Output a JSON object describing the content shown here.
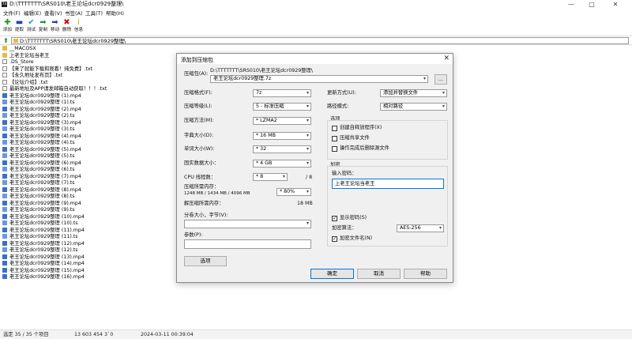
{
  "window": {
    "title": "D:\\TTTTTTT\\SRS010\\老王论坛dcr0929整理\\",
    "logo": "7z",
    "minimize": "—",
    "maximize": "□",
    "close": "✕"
  },
  "menu": [
    "文件(F)",
    "编辑(E)",
    "查看(V)",
    "书签(A)",
    "工具(T)",
    "帮助(H)"
  ],
  "toolbar": [
    {
      "label": "添加",
      "icon": "plus-icon",
      "glyph": "✚",
      "color": "#1a9a1a"
    },
    {
      "label": "提取",
      "icon": "minus-icon",
      "glyph": "▬",
      "color": "#1d3fbf"
    },
    {
      "label": "测试",
      "icon": "check-icon",
      "glyph": "✔",
      "color": "#1aa0b8"
    },
    {
      "label": "复制",
      "icon": "copy-arrow-icon",
      "glyph": "➡",
      "color": "#1a9a4a"
    },
    {
      "label": "移动",
      "icon": "move-arrow-icon",
      "glyph": "➡",
      "color": "#1d3fbf"
    },
    {
      "label": "删除",
      "icon": "delete-icon",
      "glyph": "✖",
      "color": "#d01010"
    },
    {
      "label": "信息",
      "icon": "info-icon",
      "glyph": "i",
      "color": "#c9a000"
    }
  ],
  "address": {
    "path": "D:\\TTTTTTT\\SRS010\\老王论坛dcr0929整理\\"
  },
  "files": [
    {
      "name": "__MACOSX",
      "type": "folder"
    },
    {
      "name": "上老王论坛当老王",
      "type": "folder"
    },
    {
      "name": ".DS_Store",
      "type": "file"
    },
    {
      "name": "【来了就能下载和观看！纯免费】.txt",
      "type": "file"
    },
    {
      "name": "【永久地址发布页】.txt",
      "type": "file"
    },
    {
      "name": "【论坛介绍】.txt",
      "type": "file"
    },
    {
      "name": "最新地址及APP请发邮箱自动获取！！！.txt",
      "type": "file"
    },
    {
      "name": "老王论坛dcr0929整理 (1).mp4",
      "type": "media"
    },
    {
      "name": "老王论坛dcr0929整理 (1).ts",
      "type": "ts"
    },
    {
      "name": "老王论坛dcr0929整理 (2).mp4",
      "type": "media"
    },
    {
      "name": "老王论坛dcr0929整理 (2).ts",
      "type": "ts"
    },
    {
      "name": "老王论坛dcr0929整理 (3).mp4",
      "type": "media"
    },
    {
      "name": "老王论坛dcr0929整理 (3).ts",
      "type": "ts"
    },
    {
      "name": "老王论坛dcr0929整理 (4).mp4",
      "type": "media"
    },
    {
      "name": "老王论坛dcr0929整理 (4).ts",
      "type": "ts"
    },
    {
      "name": "老王论坛dcr0929整理 (5).mp4",
      "type": "media"
    },
    {
      "name": "老王论坛dcr0929整理 (5).ts",
      "type": "ts"
    },
    {
      "name": "老王论坛dcr0929整理 (6).mp4",
      "type": "media"
    },
    {
      "name": "老王论坛dcr0929整理 (6).ts",
      "type": "ts"
    },
    {
      "name": "老王论坛dcr0929整理 (7).mp4",
      "type": "media"
    },
    {
      "name": "老王论坛dcr0929整理 (7).ts",
      "type": "ts"
    },
    {
      "name": "老王论坛dcr0929整理 (8).mp4",
      "type": "media"
    },
    {
      "name": "老王论坛dcr0929整理 (8).ts",
      "type": "ts"
    },
    {
      "name": "老王论坛dcr0929整理 (9).mp4",
      "type": "media"
    },
    {
      "name": "老王论坛dcr0929整理 (9).ts",
      "type": "ts"
    },
    {
      "name": "老王论坛dcr0929整理 (10).mp4",
      "type": "media"
    },
    {
      "name": "老王论坛dcr0929整理 (10).ts",
      "type": "ts"
    },
    {
      "name": "老王论坛dcr0929整理 (11).mp4",
      "type": "media"
    },
    {
      "name": "老王论坛dcr0929整理 (11).ts",
      "type": "ts"
    },
    {
      "name": "老王论坛dcr0929整理 (12).mp4",
      "type": "media"
    },
    {
      "name": "老王论坛dcr0929整理 (12).ts",
      "type": "ts"
    },
    {
      "name": "老王论坛dcr0929整理 (13).mp4",
      "type": "media"
    },
    {
      "name": "老王论坛dcr0929整理 (14).mp4",
      "type": "media"
    },
    {
      "name": "老王论坛dcr0929整理 (15).mp4",
      "type": "media"
    },
    {
      "name": "老王论坛dcr0929整理 (16).mp4",
      "type": "media"
    }
  ],
  "status": {
    "selection": "选定 35 / 35 个项目",
    "size": "13 603 454 3`0",
    "modified": "2024-03-11 00:39:04"
  },
  "dialog": {
    "title": "添加到压缩包",
    "close": "✕",
    "archive_label": "压缩包(A):",
    "archive_dir": "D:\\TTTTTTT\\SRS010\\老王论坛dcr0929整理\\",
    "archive_name": "老王论坛dcr0929整理.7z",
    "browse": "...",
    "format_label": "压缩格式(F):",
    "format_value": "7z",
    "level_label": "压缩等级(L):",
    "level_value": "5 - 标准压缩",
    "method_label": "压缩方法(M):",
    "method_value": "* LZMA2",
    "dict_label": "字典大小(D):",
    "dict_value": "* 16 MB",
    "word_label": "单词大小(W):",
    "word_value": "* 32",
    "solid_label": "固实数据大小：",
    "solid_value": "* 4 GB",
    "cpu_label": "CPU 线程数：",
    "cpu_value": "* 8",
    "cpu_max": "/ 8",
    "mem_label": "压缩所需内存：",
    "mem_detail": "1248 MB / 1434 MB / 4096 MB",
    "mem_value": "* 80%",
    "decomp_label": "解压缩所需内存：",
    "decomp_value": "18 MB",
    "split_label": "分卷大小，字节(V):",
    "params_label": "参数(P):",
    "options_button": "选项",
    "update_label": "更新方式(U):",
    "update_value": "添加并替换文件",
    "path_label": "路径模式:",
    "path_value": "相对路径",
    "options_group": "选项",
    "opt_sfx": "创建自释放程序(X)",
    "opt_shared": "压缩共享文件",
    "opt_delete": "操作完成后删除源文件",
    "encrypt_group": "加密",
    "password_label": "输入密码：",
    "password_value": "上老王论坛当老王",
    "show_password": "显示密码(S)",
    "enc_method_label": "加密算法：",
    "enc_method_value": "AES-256",
    "enc_names": "加密文件名(N)",
    "ok": "确定",
    "cancel": "取消",
    "help": "帮助",
    "checked_mark": "✓"
  }
}
